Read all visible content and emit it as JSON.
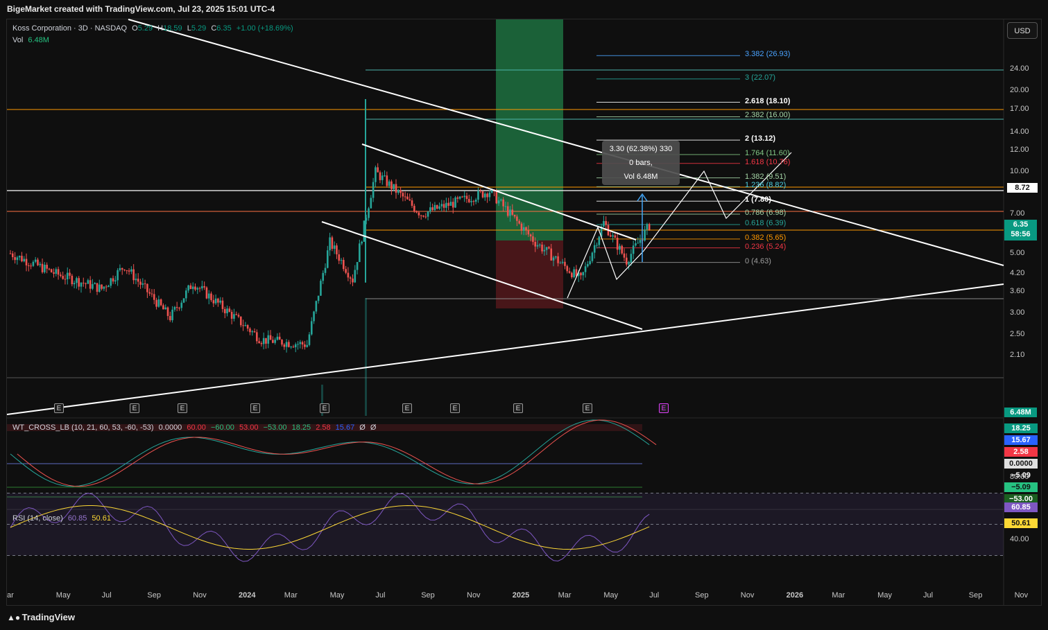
{
  "header": {
    "attribution": "BigeMarket created with TradingView.com, Jul 23, 2025 15:01 UTC-4"
  },
  "footer": {
    "brand": "TradingView"
  },
  "currency_button": "USD",
  "legend_main": {
    "symbol": "Koss Corporation · 3D · NASDAQ",
    "o_label": "O",
    "o_val": "5.29",
    "h_label": "H",
    "h_val": "18.59",
    "l_label": "L",
    "l_val": "5.29",
    "c_label": "C",
    "c_val": "6.35",
    "change": "+1.00 (+18.69%)",
    "vol_label": "Vol",
    "vol_val": "6.48M"
  },
  "legend_wt": {
    "name": "WT_CROSS_LB (10, 21, 60, 53, -60, -53)",
    "v1": "0.0000",
    "v2": "60.00",
    "v3": "−60.00",
    "v4": "53.00",
    "v5": "−53.00",
    "v6": "18.25",
    "v7": "2.58",
    "v8": "15.67",
    "v9": "Ø",
    "v10": "Ø"
  },
  "legend_rsi": {
    "name": "RSI (14, close)",
    "v1": "60.85",
    "v2": "50.61"
  },
  "tooltip": {
    "line1": "3.30 (62.38%) 330",
    "line2": "0 bars,",
    "line3": "Vol 6.48M"
  },
  "price_axis": [
    "24.00",
    "20.00",
    "17.00",
    "14.00",
    "12.00",
    "10.00",
    "7.00",
    "5.00",
    "4.20",
    "3.60",
    "3.00",
    "2.50",
    "2.10"
  ],
  "price_badges": {
    "level": "8.72",
    "price": "6.35",
    "countdown": "58:56",
    "vol": "6.48M"
  },
  "wt_badges": [
    "18.25",
    "15.67",
    "2.58",
    "0.0000",
    "−5.09",
    "−5.09",
    "−53.00"
  ],
  "rsi_axis": [
    "80.00",
    "40.00"
  ],
  "rsi_badges": [
    "60.85",
    "50.61"
  ],
  "time_axis": [
    "ar",
    "May",
    "Jul",
    "Sep",
    "Nov",
    "2024",
    "Mar",
    "May",
    "Jul",
    "Sep",
    "Nov",
    "2025",
    "Mar",
    "May",
    "Jul",
    "Sep",
    "Nov",
    "2026",
    "Mar",
    "May",
    "Jul",
    "Sep",
    "Nov"
  ],
  "events": [
    "E",
    "E",
    "E",
    "E",
    "E",
    "E",
    "E",
    "E",
    "E",
    "E"
  ],
  "fib_levels": [
    {
      "label": "3.382 (26.93)",
      "color": "#4aa3ff"
    },
    {
      "label": "3 (22.07)",
      "color": "#26a69a"
    },
    {
      "label": "2.618 (18.10)",
      "color": "#ffffff"
    },
    {
      "label": "2.382 (16.00)",
      "color": "#a5d6a7"
    },
    {
      "label": "2 (13.12)",
      "color": "#ffffff"
    },
    {
      "label": "1.764 (11.60)",
      "color": "#81c784"
    },
    {
      "label": "1.618 (10.76)",
      "color": "#f23645"
    },
    {
      "label": "1.382 (9.51)",
      "color": "#a5d6a7"
    },
    {
      "label": "1.236 (8.82)",
      "color": "#4dd0e1"
    },
    {
      "label": "1 (7.80)",
      "color": "#ffffff"
    },
    {
      "label": "0.786 (6.98)",
      "color": "#a5d6a7"
    },
    {
      "label": "0.618 (6.39)",
      "color": "#26a69a"
    },
    {
      "label": "0.382 (5.65)",
      "color": "#ff9800"
    },
    {
      "label": "0.236 (5.24)",
      "color": "#f23645"
    },
    {
      "label": "0 (4.63)",
      "color": "#9e9e9e"
    }
  ],
  "chart_data": {
    "type": "candlestick",
    "title": "Koss Corporation · 3D · NASDAQ",
    "y_scale": "log",
    "ylim": [
      1.75,
      28
    ],
    "x_range": [
      "2023-03",
      "2026-11"
    ],
    "approx_close_path": [
      {
        "x": "2023-03",
        "y": 5.0
      },
      {
        "x": "2023-05",
        "y": 4.2
      },
      {
        "x": "2023-07",
        "y": 3.7
      },
      {
        "x": "2023-08",
        "y": 4.5
      },
      {
        "x": "2023-10",
        "y": 2.9
      },
      {
        "x": "2023-11",
        "y": 3.9
      },
      {
        "x": "2024-02",
        "y": 2.4
      },
      {
        "x": "2024-04",
        "y": 2.3
      },
      {
        "x": "2024-05",
        "y": 5.5
      },
      {
        "x": "2024-06",
        "y": 4.0
      },
      {
        "x": "2024-07",
        "y": 10.0
      },
      {
        "x": "2024-09",
        "y": 7.0
      },
      {
        "x": "2024-12",
        "y": 8.5
      },
      {
        "x": "2025-02",
        "y": 5.5
      },
      {
        "x": "2025-04",
        "y": 4.0
      },
      {
        "x": "2025-05",
        "y": 6.5
      },
      {
        "x": "2025-06",
        "y": 4.7
      },
      {
        "x": "2025-07",
        "y": 6.35
      }
    ],
    "last": {
      "open": 5.29,
      "high": 18.59,
      "low": 5.29,
      "close": 6.35,
      "change": 1.0,
      "change_pct": 18.69,
      "volume": "6.48M"
    },
    "horizontal_levels": [
      8.72,
      15.8,
      7.5,
      2.2
    ],
    "measure": {
      "change": 3.3,
      "change_pct": 62.38,
      "ticks": 330,
      "bars": 0,
      "volume": "6.48M"
    },
    "indicators": {
      "wt_cross": {
        "params": [
          10,
          21,
          60,
          53,
          -60,
          -53
        ],
        "values": [
          18.25,
          15.67,
          2.58,
          0.0,
          -5.09,
          -5.09,
          -53.0
        ]
      },
      "rsi": {
        "length": 14,
        "rsi": 60.85,
        "ma": 50.61,
        "bands": [
          70,
          30
        ],
        "ylim": [
          20,
          100
        ]
      }
    }
  }
}
